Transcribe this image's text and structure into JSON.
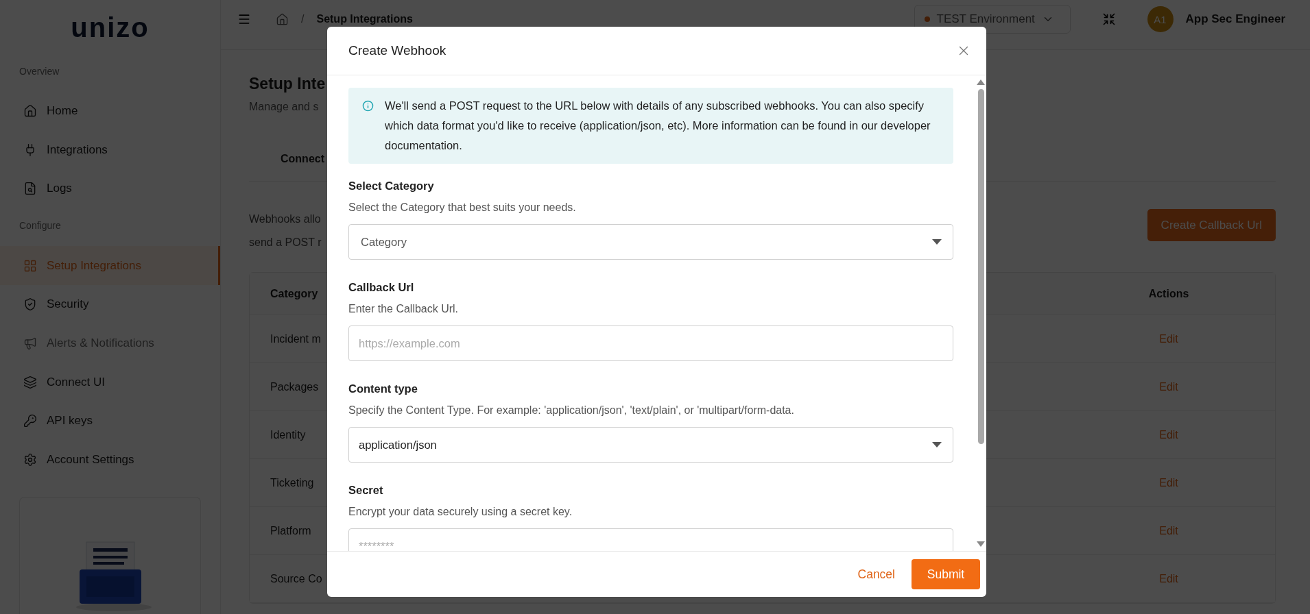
{
  "sidebar": {
    "logo": "unizo",
    "sections": [
      {
        "heading": "Overview",
        "items": [
          {
            "label": "Home",
            "selected": false,
            "disabled": false
          },
          {
            "label": "Integrations",
            "selected": false,
            "disabled": false
          },
          {
            "label": "Logs",
            "selected": false,
            "disabled": false
          }
        ]
      },
      {
        "heading": "Configure",
        "items": [
          {
            "label": "Setup Integrations",
            "selected": true,
            "disabled": false
          },
          {
            "label": "Security",
            "selected": false,
            "disabled": false
          },
          {
            "label": "Alerts & Notifications",
            "selected": false,
            "disabled": true
          },
          {
            "label": "Connect UI",
            "selected": false,
            "disabled": false
          },
          {
            "label": "API keys",
            "selected": false,
            "disabled": false
          },
          {
            "label": "Account Settings",
            "selected": false,
            "disabled": false
          }
        ]
      }
    ]
  },
  "topbar": {
    "breadcrumb": {
      "separator": "/",
      "current": "Setup Integrations"
    },
    "environment": "TEST Environment",
    "user": {
      "initials": "A1",
      "name": "App Sec Engineer"
    }
  },
  "page": {
    "title": "Setup Inte",
    "subtitle": "Manage and s",
    "tab": "Connect",
    "description_lines": [
      "Webhooks allo",
      "send a POST r"
    ],
    "create_button": "Create Callback Url",
    "table": {
      "columns": [
        "Category",
        "Actions"
      ],
      "rows": [
        {
          "category": "Incident m",
          "action": "Edit"
        },
        {
          "category": "Packages",
          "action": "Edit"
        },
        {
          "category": "Identity",
          "action": "Edit"
        },
        {
          "category": "Ticketing",
          "action": "Edit"
        },
        {
          "category": "Platform",
          "action": "Edit"
        },
        {
          "category": "Source Co",
          "action": "Edit"
        }
      ]
    }
  },
  "modal": {
    "title": "Create Webhook",
    "info": "We'll send a POST request to the URL below with details of any subscribed webhooks. You can also specify which data format you'd like to receive (application/json, etc). More information can be found in our developer documentation.",
    "fields": [
      {
        "kind": "select",
        "label": "Select Category",
        "help": "Select the Category that best suits your needs.",
        "placeholder": "Category"
      },
      {
        "kind": "text",
        "label": "Callback Url",
        "help": "Enter the Callback Url.",
        "placeholder": "https://example.com"
      },
      {
        "kind": "select",
        "label": "Content type",
        "help": "Specify the Content Type. For example: 'application/json', 'text/plain', or 'multipart/form-data.",
        "value": "application/json"
      },
      {
        "kind": "password",
        "label": "Secret",
        "help": "Encrypt your data securely using a secret key.",
        "placeholder": "********"
      }
    ],
    "buttons": {
      "cancel": "Cancel",
      "submit": "Submit"
    }
  }
}
